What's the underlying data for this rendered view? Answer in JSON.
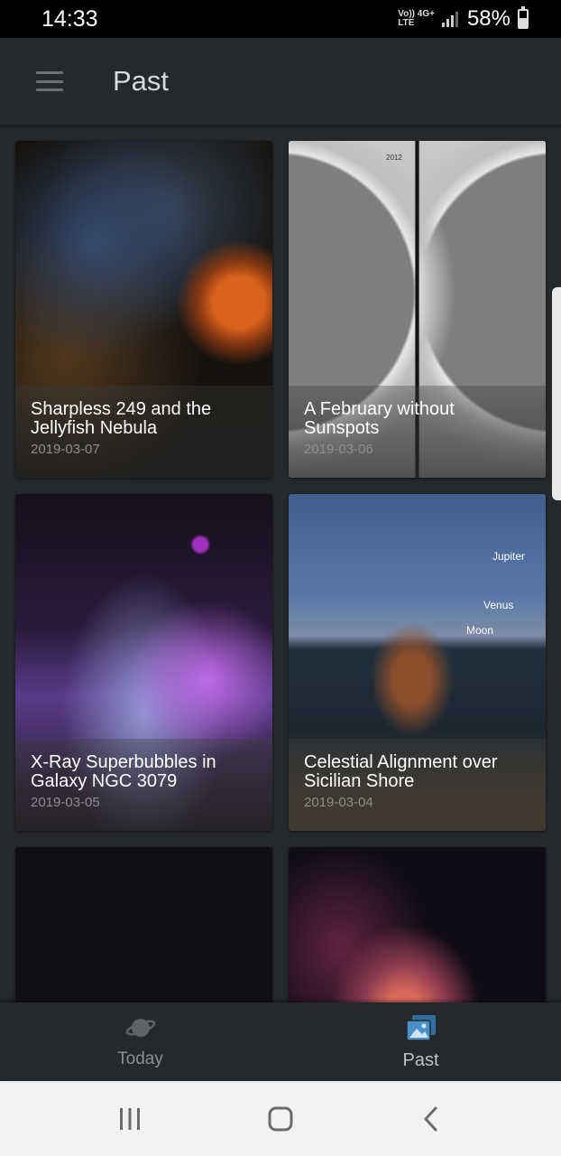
{
  "status_bar": {
    "time": "14:33",
    "network_top": "Vo)) 4G+",
    "network_bottom": "LTE",
    "battery_percent": "58%",
    "battery_level": 0.58
  },
  "app_bar": {
    "title": "Past",
    "menu_icon": "hamburger-menu-icon"
  },
  "cards": [
    {
      "title": "Sharpless 249 and the Jellyfish Nebula",
      "date": "2019-03-07"
    },
    {
      "title": "A February without Sunspots",
      "date": "2019-03-06",
      "image_text": "2012"
    },
    {
      "title": "X-Ray Superbubbles in Galaxy NGC 3079",
      "date": "2019-03-05"
    },
    {
      "title": "Celestial Alignment over Sicilian Shore",
      "date": "2019-03-04",
      "image_labels": [
        "Jupiter",
        "Venus",
        "Moon"
      ]
    }
  ],
  "bottom_nav": {
    "items": [
      {
        "label": "Today",
        "icon": "planet-icon",
        "active": false
      },
      {
        "label": "Past",
        "icon": "gallery-icon",
        "active": true
      }
    ],
    "active_color": "#4a90c8"
  },
  "system_nav": {
    "buttons": [
      "recent-apps-icon",
      "home-icon",
      "back-icon"
    ]
  }
}
